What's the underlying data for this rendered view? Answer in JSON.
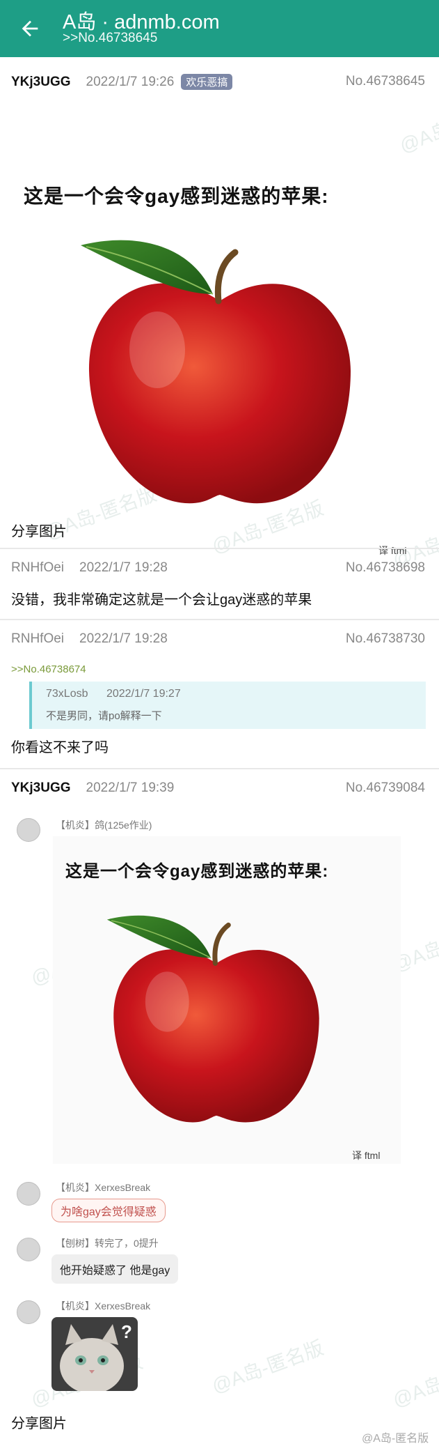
{
  "header": {
    "title": "A岛 · adnmb.com",
    "subtitle": ">>No.46738645"
  },
  "posts": [
    {
      "user": "YKj3UGG",
      "time": "2022/1/7 19:26",
      "tag": "欢乐恶搞",
      "no": "No.46738645",
      "image_caption": "这是一个会令gay感到迷惑的苹果:",
      "image_credit": "译 ftml",
      "text": "分享图片"
    },
    {
      "user": "RNHfOei",
      "time": "2022/1/7 19:28",
      "no": "No.46738698",
      "text": "没错，我非常确定这就是一个会让gay迷惑的苹果"
    },
    {
      "user": "RNHfOei",
      "time": "2022/1/7 19:28",
      "no": "No.46738730",
      "ref": ">>No.46738674",
      "quote": {
        "user": "73xLosb",
        "time": "2022/1/7 19:27",
        "text": "不是男同，请po解释一下"
      },
      "text": "你看这不来了吗"
    },
    {
      "user": "YKj3UGG",
      "time": "2022/1/7 19:39",
      "no": "No.46739084",
      "chat": [
        {
          "name": "【机炎】鸽(125e作业)",
          "image_caption": "这是一个会令gay感到迷惑的苹果:",
          "image_credit": "译 ftml"
        },
        {
          "name": "【机炎】XerxesBreak",
          "text": "为啥gay会觉得疑惑"
        },
        {
          "name": "【刨树】转完了，0提升",
          "text": "他开始疑惑了  他是gay"
        },
        {
          "name": "【机炎】XerxesBreak"
        }
      ],
      "text": "分享图片"
    }
  ],
  "watermark": "@A岛-匿名版",
  "weibo_mark": "@A岛-匿名版"
}
